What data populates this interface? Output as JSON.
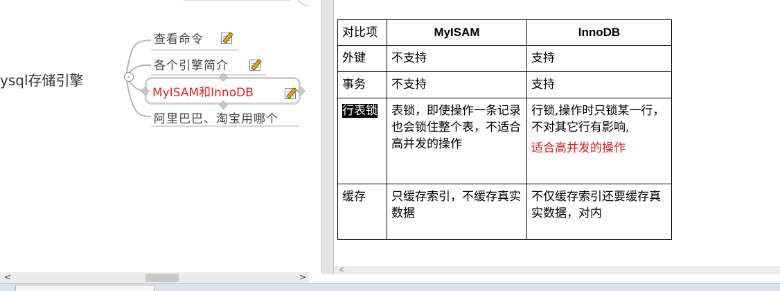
{
  "mindmap": {
    "top_cutoff_text": "",
    "root_label": "ysql存储引擎",
    "children": [
      {
        "label": "查看命令",
        "has_note": true
      },
      {
        "label": "各个引擎简介",
        "has_note": true
      },
      {
        "label": "MyISAM和InnoDB",
        "has_note": true,
        "selected": true,
        "color": "#e02020"
      },
      {
        "label": "阿里巴巴、淘宝用哪个",
        "has_note": false
      }
    ],
    "collapse_symbol": "-"
  },
  "table": {
    "headers": [
      "对比项",
      "MyISAM",
      "InnoDB"
    ],
    "rows": [
      {
        "feature": "外键",
        "myisam": "不支持",
        "innodb": "支持"
      },
      {
        "feature": "事务",
        "myisam": "不支持",
        "innodb": "支持"
      },
      {
        "feature": "行表锁",
        "myisam": "表锁，即使操作一条记录也会锁住整个表，不适合高并发的操作",
        "innodb": "行锁,操作时只锁某一行，不对其它行有影响,",
        "innodb_note": "适合高并发的操作"
      },
      {
        "feature": "缓存",
        "myisam": "只缓存索引，不缓存真实数据",
        "innodb": "不仅缓存索引还要缓存真实数据，对内"
      }
    ]
  },
  "scroll": {
    "left": "<",
    "right": ">",
    "down": "v"
  },
  "colors": {
    "accent_red": "#d82020",
    "mindmap_text": "#404040"
  }
}
